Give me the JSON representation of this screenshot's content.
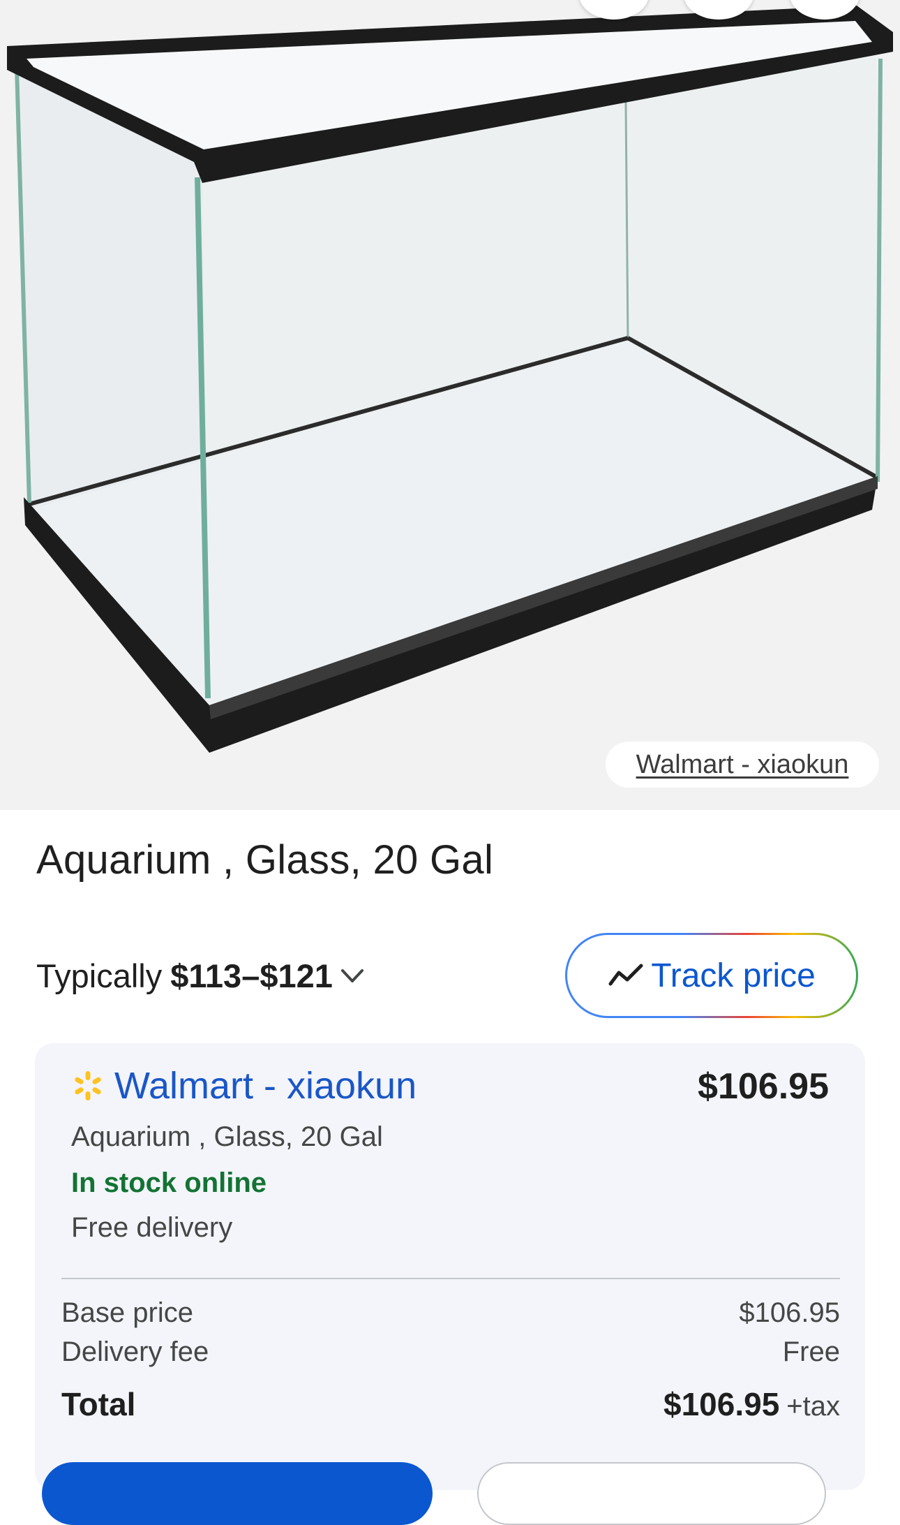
{
  "hero": {
    "image_alt": "Aquarium glass tank product photo",
    "source_chip_label": "Walmart - xiaokun"
  },
  "product": {
    "title": "Aquarium , Glass, 20 Gal"
  },
  "pricing": {
    "typical_label": "Typically",
    "typical_range": "$113–$121",
    "track_price_label": "Track price"
  },
  "offer": {
    "store_name": "Walmart - xiaokun",
    "price": "$106.95",
    "description": "Aquarium , Glass, 20 Gal",
    "stock_status": "In stock online",
    "delivery": "Free delivery",
    "breakdown": {
      "base_price_label": "Base price",
      "base_price_value": "$106.95",
      "delivery_fee_label": "Delivery fee",
      "delivery_fee_value": "Free",
      "total_label": "Total",
      "total_value": "$106.95",
      "tax_suffix": "+tax"
    }
  },
  "colors": {
    "accent_blue": "#0b57d0",
    "store_link_blue": "#1a56c8",
    "in_stock_green": "#137333",
    "walmart_spark": "#ffc220"
  }
}
